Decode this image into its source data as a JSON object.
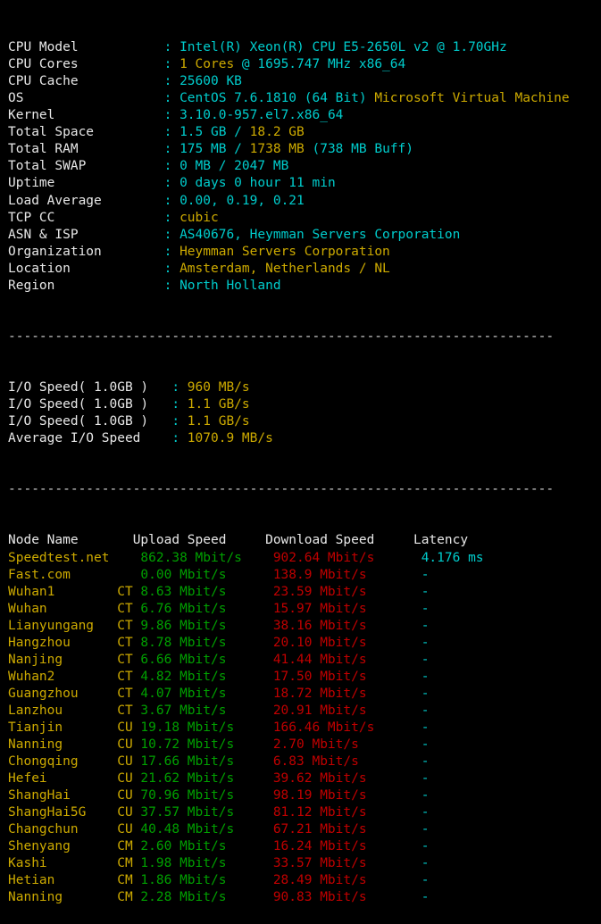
{
  "terminal": {
    "separator": "----------------------------------------------------------------------",
    "sysinfo": [
      {
        "label": "CPU Model",
        "colon": ":",
        "value": "Intel(R) Xeon(R) CPU E5-2650L v2 @ 1.70GHz",
        "value_color": "cyan",
        "value2": "",
        "value2_color": "yellow"
      },
      {
        "label": "CPU Cores",
        "colon": ":",
        "value": "1 Cores",
        "value_color": "yellow",
        "value2": " @ 1695.747 MHz x86_64",
        "value2_color": "cyan"
      },
      {
        "label": "CPU Cache",
        "colon": ":",
        "value": "25600 KB",
        "value_color": "cyan",
        "value2": "",
        "value2_color": "yellow"
      },
      {
        "label": "OS",
        "colon": ":",
        "value": "CentOS 7.6.1810 (64 Bit) ",
        "value_color": "cyan",
        "value2": "Microsoft Virtual Machine",
        "value2_color": "yellow"
      },
      {
        "label": "Kernel",
        "colon": ":",
        "value": "3.10.0-957.el7.x86_64",
        "value_color": "cyan",
        "value2": "",
        "value2_color": "yellow"
      },
      {
        "label": "Total Space",
        "colon": ":",
        "value": "1.5 GB / ",
        "value_color": "cyan",
        "value2": "18.2 GB",
        "value2_color": "yellow"
      },
      {
        "label": "Total RAM",
        "colon": ":",
        "value": "175 MB / ",
        "value_color": "cyan",
        "value2": "1738 MB",
        "value2_color": "yellow",
        "value3": " (738 MB Buff)",
        "value3_color": "cyan"
      },
      {
        "label": "Total SWAP",
        "colon": ":",
        "value": "0 MB / 2047 MB",
        "value_color": "cyan",
        "value2": "",
        "value2_color": "yellow"
      },
      {
        "label": "Uptime",
        "colon": ":",
        "value": "0 days 0 hour 11 min",
        "value_color": "cyan",
        "value2": "",
        "value2_color": "yellow"
      },
      {
        "label": "Load Average",
        "colon": ":",
        "value": "0.00, 0.19, 0.21",
        "value_color": "cyan",
        "value2": "",
        "value2_color": "yellow"
      },
      {
        "label": "TCP CC",
        "colon": ":",
        "value": "cubic",
        "value_color": "yellow",
        "value2": "",
        "value2_color": "yellow"
      },
      {
        "label": "ASN & ISP",
        "colon": ":",
        "value": "AS40676, Heymman Servers Corporation",
        "value_color": "cyan",
        "value2": "",
        "value2_color": "yellow"
      },
      {
        "label": "Organization",
        "colon": ":",
        "value": "Heymman Servers Corporation",
        "value_color": "yellow",
        "value2": "",
        "value2_color": "yellow"
      },
      {
        "label": "Location",
        "colon": ":",
        "value": "Amsterdam, Netherlands / NL",
        "value_color": "yellow",
        "value2": "",
        "value2_color": "yellow"
      },
      {
        "label": "Region",
        "colon": ":",
        "value": "North Holland",
        "value_color": "cyan",
        "value2": "",
        "value2_color": "yellow"
      }
    ],
    "io": [
      {
        "label": "I/O Speed( 1.0GB )",
        "colon": ":",
        "value": "960 MB/s"
      },
      {
        "label": "I/O Speed( 1.0GB )",
        "colon": ":",
        "value": "1.1 GB/s"
      },
      {
        "label": "I/O Speed( 1.0GB )",
        "colon": ":",
        "value": "1.1 GB/s"
      },
      {
        "label": "Average I/O Speed",
        "colon": ":",
        "value": "1070.9 MB/s"
      }
    ],
    "speedtest": {
      "headers": {
        "node": "Node Name",
        "upload": "Upload Speed",
        "download": "Download Speed",
        "latency": "Latency"
      },
      "rows": [
        {
          "node": "Speedtest.net",
          "isp": "",
          "upload": "862.38 Mbit/s",
          "download": "902.64 Mbit/s",
          "latency": "4.176 ms"
        },
        {
          "node": "Fast.com",
          "isp": "",
          "upload": "0.00 Mbit/s",
          "download": "138.9 Mbit/s",
          "latency": "-"
        },
        {
          "node": "Wuhan1",
          "isp": "CT",
          "upload": "8.63 Mbit/s",
          "download": "23.59 Mbit/s",
          "latency": "-"
        },
        {
          "node": "Wuhan",
          "isp": "CT",
          "upload": "6.76 Mbit/s",
          "download": "15.97 Mbit/s",
          "latency": "-"
        },
        {
          "node": "Lianyungang",
          "isp": "CT",
          "upload": "9.86 Mbit/s",
          "download": "38.16 Mbit/s",
          "latency": "-"
        },
        {
          "node": "Hangzhou",
          "isp": "CT",
          "upload": "8.78 Mbit/s",
          "download": "20.10 Mbit/s",
          "latency": "-"
        },
        {
          "node": "Nanjing",
          "isp": "CT",
          "upload": "6.66 Mbit/s",
          "download": "41.44 Mbit/s",
          "latency": "-"
        },
        {
          "node": "Wuhan2",
          "isp": "CT",
          "upload": "4.82 Mbit/s",
          "download": "17.50 Mbit/s",
          "latency": "-"
        },
        {
          "node": "Guangzhou",
          "isp": "CT",
          "upload": "4.07 Mbit/s",
          "download": "18.72 Mbit/s",
          "latency": "-"
        },
        {
          "node": "Lanzhou",
          "isp": "CT",
          "upload": "3.67 Mbit/s",
          "download": "20.91 Mbit/s",
          "latency": "-"
        },
        {
          "node": "Tianjin",
          "isp": "CU",
          "upload": "19.18 Mbit/s",
          "download": "166.46 Mbit/s",
          "latency": "-"
        },
        {
          "node": "Nanning",
          "isp": "CU",
          "upload": "10.72 Mbit/s",
          "download": "2.70 Mbit/s",
          "latency": "-"
        },
        {
          "node": "Chongqing",
          "isp": "CU",
          "upload": "17.66 Mbit/s",
          "download": "6.83 Mbit/s",
          "latency": "-"
        },
        {
          "node": "Hefei",
          "isp": "CU",
          "upload": "21.62 Mbit/s",
          "download": "39.62 Mbit/s",
          "latency": "-"
        },
        {
          "node": "ShangHai",
          "isp": "CU",
          "upload": "70.96 Mbit/s",
          "download": "98.19 Mbit/s",
          "latency": "-"
        },
        {
          "node": "ShangHai5G",
          "isp": "CU",
          "upload": "37.57 Mbit/s",
          "download": "81.12 Mbit/s",
          "latency": "-"
        },
        {
          "node": "Changchun",
          "isp": "CU",
          "upload": "40.48 Mbit/s",
          "download": "67.21 Mbit/s",
          "latency": "-"
        },
        {
          "node": "Shenyang",
          "isp": "CM",
          "upload": "2.60 Mbit/s",
          "download": "16.24 Mbit/s",
          "latency": "-"
        },
        {
          "node": "Kashi",
          "isp": "CM",
          "upload": "1.98 Mbit/s",
          "download": "33.57 Mbit/s",
          "latency": "-"
        },
        {
          "node": "Hetian",
          "isp": "CM",
          "upload": "1.86 Mbit/s",
          "download": "28.49 Mbit/s",
          "latency": "-"
        },
        {
          "node": "Nanning",
          "isp": "CM",
          "upload": "2.28 Mbit/s",
          "download": "90.83 Mbit/s",
          "latency": "-"
        }
      ]
    }
  }
}
